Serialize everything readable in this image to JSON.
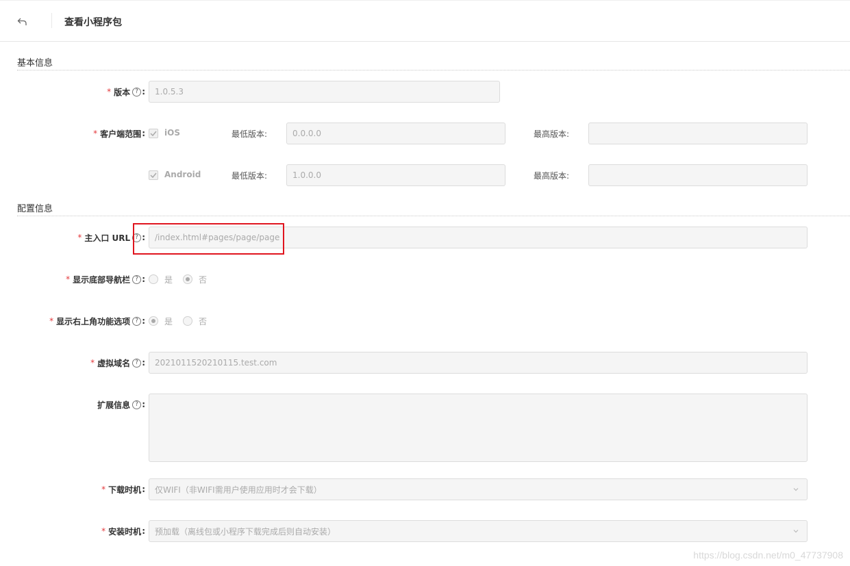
{
  "header": {
    "title": "查看小程序包"
  },
  "sections": {
    "basic": "基本信息",
    "config": "配置信息"
  },
  "fields": {
    "version": {
      "label": "版本",
      "value": "1.0.5.3"
    },
    "client_scope": {
      "label": "客户端范围",
      "ios": {
        "label": "iOS",
        "checked": true,
        "min_label": "最低版本:",
        "min_value": "0.0.0.0",
        "max_label": "最高版本:",
        "max_value": ""
      },
      "android": {
        "label": "Android",
        "checked": true,
        "min_label": "最低版本:",
        "min_value": "1.0.0.0",
        "max_label": "最高版本:",
        "max_value": ""
      }
    },
    "main_url": {
      "label": "主入口 URL",
      "value": "/index.html#pages/page/page"
    },
    "show_bottom_nav": {
      "label": "显示底部导航栏",
      "yes": "是",
      "no": "否",
      "selected": "no"
    },
    "show_top_right": {
      "label": "显示右上角功能选项",
      "yes": "是",
      "no": "否",
      "selected": "yes"
    },
    "virtual_domain": {
      "label": "虚拟域名",
      "value": "2021011520210115.test.com"
    },
    "ext_info": {
      "label": "扩展信息",
      "value": ""
    },
    "download_timing": {
      "label": "下载时机",
      "value": "仅WIFI（非WIFI需用户使用应用时才会下载）"
    },
    "install_timing": {
      "label": "安装时机",
      "value": "预加载（离线包或小程序下载完成后则自动安装）"
    }
  },
  "watermark": "https://blog.csdn.net/m0_47737908",
  "colors": {
    "required": "#e4393c",
    "highlight": "#e0141e"
  }
}
